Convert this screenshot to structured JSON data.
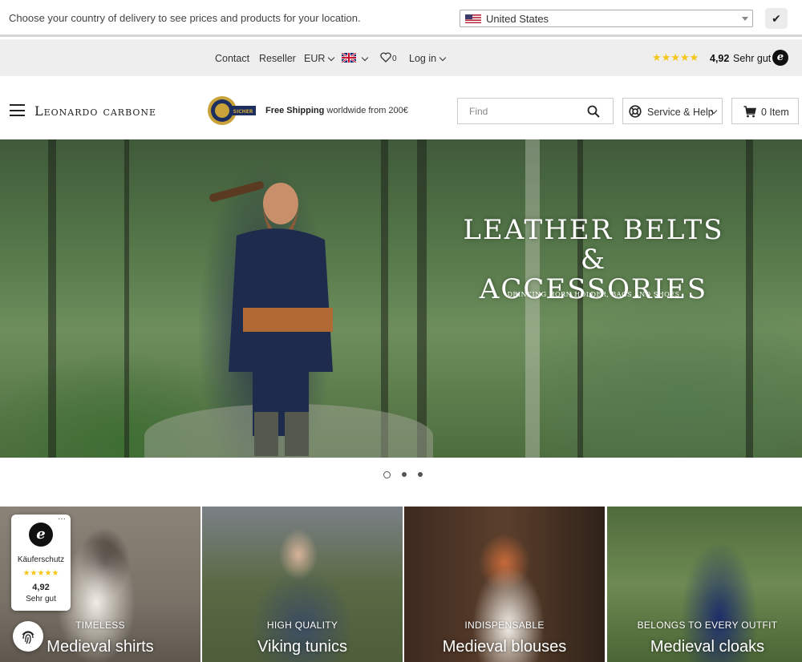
{
  "country_bar": {
    "message": "Choose your country of delivery to see prices and products for your location.",
    "selected_country": "United States",
    "confirm_label": "✔"
  },
  "top_nav": {
    "contact": "Contact",
    "reseller": "Reseller",
    "currency": "EUR",
    "wishlist_count": "0",
    "login": "Log in",
    "rating_stars": "★★★★★",
    "rating_score": "4,92",
    "rating_word": "Sehr gut",
    "trusted_logo": "e"
  },
  "header": {
    "logo_text": "Leonardo carbone",
    "seal_text": "SICHER",
    "shipping_bold": "Free Shipping",
    "shipping_rest": " worldwide from 200€",
    "search_placeholder": "Find",
    "service_label": "Service & Help",
    "cart_count_label": "0 Item"
  },
  "hero": {
    "title_line1": "LEATHER BELTS &",
    "title_line2": "ACCESSORIES",
    "subtitle": "DRINKING HORN HOLDER, BAGS AND SHOES",
    "slide_count": 3,
    "active_slide": 1
  },
  "categories": [
    {
      "tagline": "TIMELESS",
      "title": "Medieval shirts"
    },
    {
      "tagline": "HIGH QUALITY",
      "title": "Viking tunics"
    },
    {
      "tagline": "INDISPENSABLE",
      "title": "Medieval blouses"
    },
    {
      "tagline": "BELONGS TO EVERY OUTFIT",
      "title": "Medieval cloaks"
    }
  ],
  "trusted_badge": {
    "logo": "e",
    "label": "Käuferschutz",
    "stars": "★★★★★",
    "score": "4,92",
    "word": "Sehr gut",
    "more": "···"
  },
  "colors": {
    "star": "#f5c518",
    "nav_bg": "#eeeeee",
    "border": "#cccccc"
  },
  "icons": [
    "us-flag-icon",
    "uk-flag-icon",
    "heart-icon",
    "hamburger-icon",
    "search-icon",
    "lifebuoy-icon",
    "cart-icon",
    "fingerprint-icon"
  ]
}
